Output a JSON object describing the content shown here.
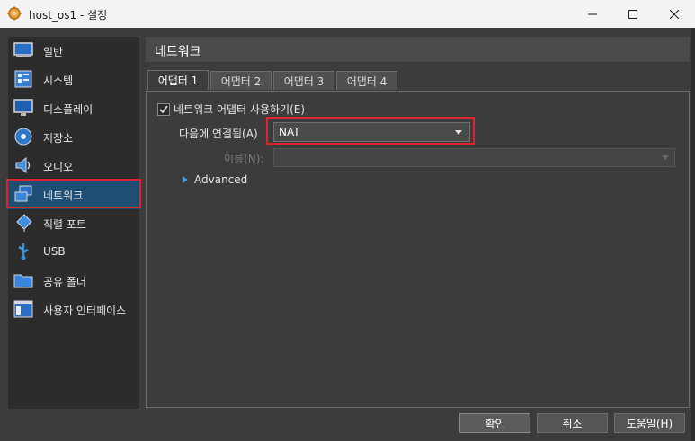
{
  "window": {
    "title": "host_os1 - 설정",
    "minimize_glyph": "—",
    "maximize_glyph": "☐",
    "close_glyph": "✕"
  },
  "sidebar": {
    "items": [
      {
        "label": "일반",
        "icon": "general-icon"
      },
      {
        "label": "시스템",
        "icon": "system-icon"
      },
      {
        "label": "디스플레이",
        "icon": "display-icon"
      },
      {
        "label": "저장소",
        "icon": "storage-icon"
      },
      {
        "label": "오디오",
        "icon": "audio-icon"
      },
      {
        "label": "네트워크",
        "icon": "network-icon",
        "active": true
      },
      {
        "label": "직렬 포트",
        "icon": "serial-port-icon"
      },
      {
        "label": "USB",
        "icon": "usb-icon"
      },
      {
        "label": "공유 폴더",
        "icon": "shared-folder-icon"
      },
      {
        "label": "사용자 인터페이스",
        "icon": "user-interface-icon"
      }
    ]
  },
  "header": {
    "title": "네트워크"
  },
  "tabs": [
    {
      "label": "어댑터 1",
      "selected": true
    },
    {
      "label": "어댑터 2"
    },
    {
      "label": "어댑터 3"
    },
    {
      "label": "어댑터 4"
    }
  ],
  "adapter": {
    "enable_label": "네트워크 어댑터 사용하기(E)",
    "enabled": true,
    "attached_label": "다음에 연결됨(A)",
    "attached_value": "NAT",
    "name_label": "이름(N):",
    "name_value": "",
    "advanced_label": "Advanced"
  },
  "buttons": {
    "ok": "확인",
    "cancel": "취소",
    "help": "도움말(H)"
  },
  "colors": {
    "accent": "#3d9be9",
    "highlight": "#d9262c",
    "selection": "#1e4e73"
  }
}
